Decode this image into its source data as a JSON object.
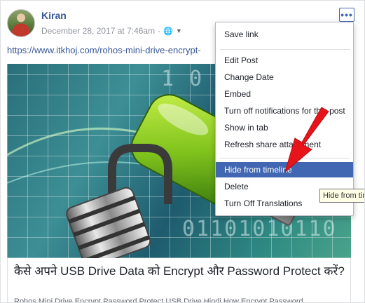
{
  "post": {
    "author": "Kiran",
    "date": "December 28, 2017 at 7:46am",
    "link_text": "https://www.itkhoj.com/rohos-mini-drive-encrypt-",
    "more_label": "•••"
  },
  "link_preview": {
    "image_text_top": "1 0 1",
    "image_text_bottom": "01101010110",
    "title": "कैसे अपने USB Drive Data को Encrypt और Password Protect करें?",
    "subtitle": "Rohos Mini Drive Encrypt Password Protect USB Drive Hindi How Encrypt Password"
  },
  "menu": {
    "items": [
      "Save link",
      "Edit Post",
      "Change Date",
      "Embed",
      "Turn off notifications for this post",
      "Show in tab",
      "Refresh share attachment",
      "Hide from timeline",
      "Delete",
      "Turn Off Translations"
    ],
    "highlighted": "Hide from timeline"
  },
  "tooltip": "Hide from timeline",
  "colors": {
    "brand_blue": "#4267b2",
    "link": "#385898",
    "annotation_red": "#e8141b"
  }
}
